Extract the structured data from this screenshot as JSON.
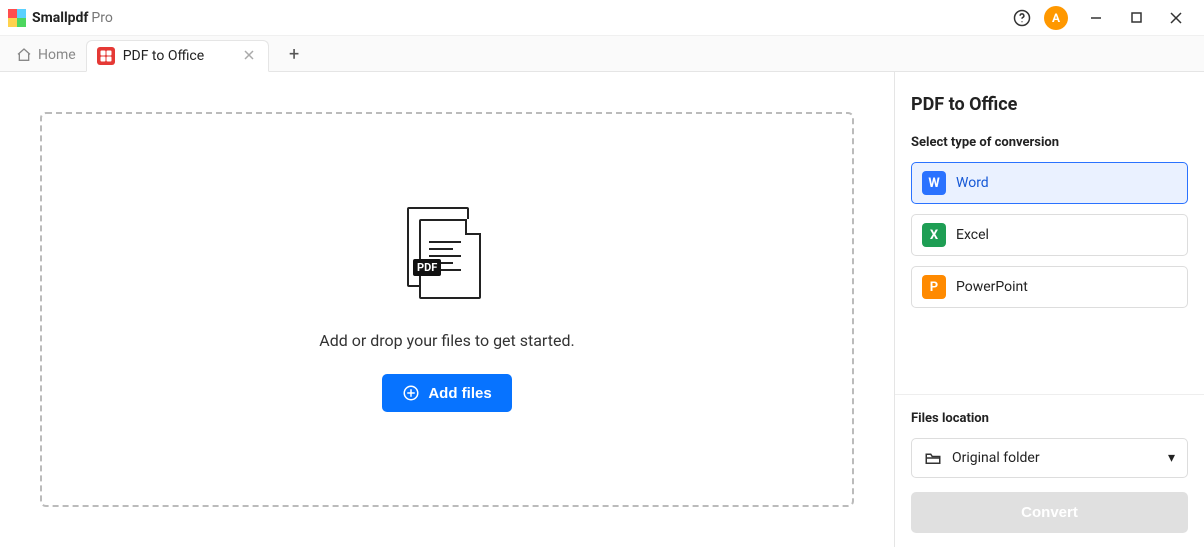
{
  "app": {
    "brand": "Smallpdf",
    "edition": "Pro",
    "avatar_initial": "A"
  },
  "nav": {
    "home_label": "Home",
    "tab": {
      "title": "PDF to Office"
    }
  },
  "main": {
    "drop_hint": "Add or drop your files to get started.",
    "add_files_label": "Add files",
    "file_badge": "PDF"
  },
  "sidebar": {
    "title": "PDF to Office",
    "conversion_label": "Select type of conversion",
    "options": {
      "word": "Word",
      "excel": "Excel",
      "powerpoint": "PowerPoint"
    },
    "icon_letters": {
      "word": "W",
      "excel": "X",
      "powerpoint": "P"
    },
    "files_location_label": "Files location",
    "files_location_value": "Original folder",
    "convert_label": "Convert"
  }
}
